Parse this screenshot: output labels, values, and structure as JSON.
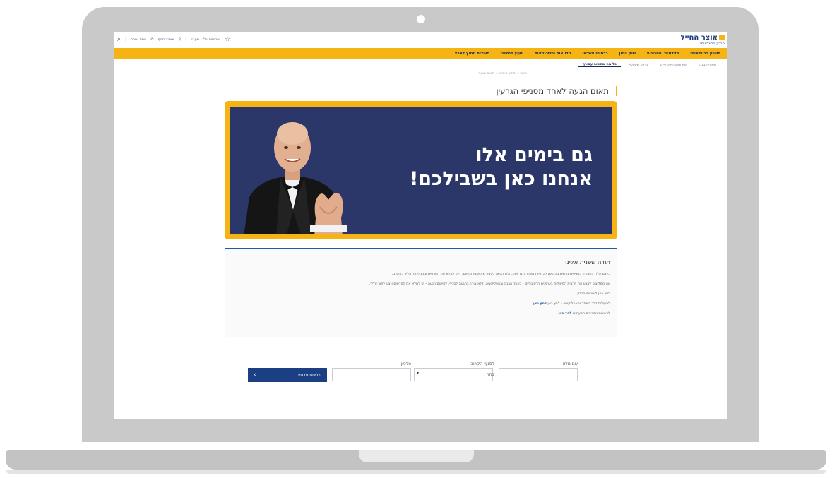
{
  "site": {
    "logo_main": "אוצר החייל",
    "logo_sub": "הבנק הבינלאומי"
  },
  "util": {
    "phone": "פתח שיחה",
    "branch": "איתור סניף",
    "link": "שירותים בלי - מעבר"
  },
  "nav": {
    "items": [
      "חשבון בבינלאומי",
      "פקדונות וחסכונות",
      "שוק ההון",
      "כרטיסי אשראי",
      "הלוואות ומשכנתאות",
      "ייעוץ פנסיוני",
      "פעילות מחוץ לארץ"
    ]
  },
  "subnav": {
    "items": [
      "טפסי הבנק",
      "שירותים דיגיטליים",
      "מידע שימושי",
      "כל מה שחשוב עבורך"
    ]
  },
  "breadcrumb": "ראשי > מידע שימושי > תאום הגעה",
  "page_title": "תאום הגעה לאחד מסניפי הגרעין",
  "banner": {
    "line1": "גם בימים אלו",
    "line2": "אנחנו כאן בשבילכם!"
  },
  "info": {
    "title": "תודה שפנית אלינו",
    "p1": "בימים אלה העבודה בסניפים נעשית בהתאם להנחיות משרד הבריאות, ולכן הגעה לסניף מתואמת מראש. ניתן למלא את הפרטים ונציג יחזור אליך בהקדם.",
    "p2": "אנו ממליצים לבצע את מרבית הפעולות בערוצים הדיגיטליים - באתר הבנק ובאפליקציה, ללא צורך בהגעה לסניף. לתיאום הגעה - יש למלא את הפרטים ונציג יחזור אליך.",
    "p2b": "לחץ כאן לשירותי הבנק",
    "p3": "לפעולות דרך האתר והאפליקציה - לחץ כאן",
    "p3_link": "לחץ כאן",
    "p4": "לרשימת הסניפים הפעילים",
    "p4_link": "לחץ כאן"
  },
  "form": {
    "name_label": "שם מלא",
    "branch_label": "לסניף הקרוב",
    "branch_value": "בחר",
    "phone_label": "טלפון",
    "submit_label": "שליחת פרטים"
  }
}
